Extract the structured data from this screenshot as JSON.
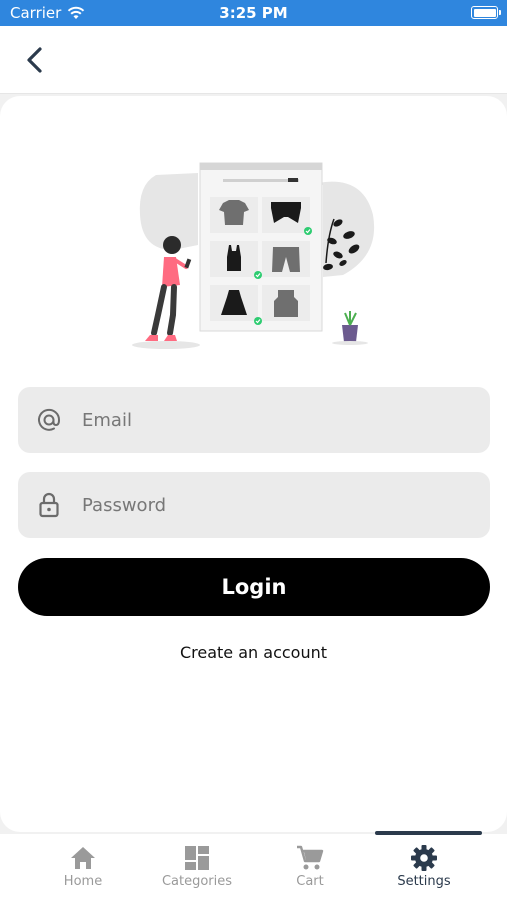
{
  "status_bar": {
    "carrier": "Carrier",
    "time": "3:25 PM"
  },
  "form": {
    "email_placeholder": "Email",
    "password_placeholder": "Password",
    "login_label": "Login",
    "create_account_label": "Create an account"
  },
  "tabs": [
    {
      "label": "Home",
      "icon": "home-icon"
    },
    {
      "label": "Categories",
      "icon": "grid-icon"
    },
    {
      "label": "Cart",
      "icon": "cart-icon"
    },
    {
      "label": "Settings",
      "icon": "gear-icon",
      "active": true
    }
  ],
  "colors": {
    "status_bar": "#2f86de",
    "accent": "#2b3a4c",
    "button": "#000000",
    "field_bg": "#ebebeb"
  }
}
